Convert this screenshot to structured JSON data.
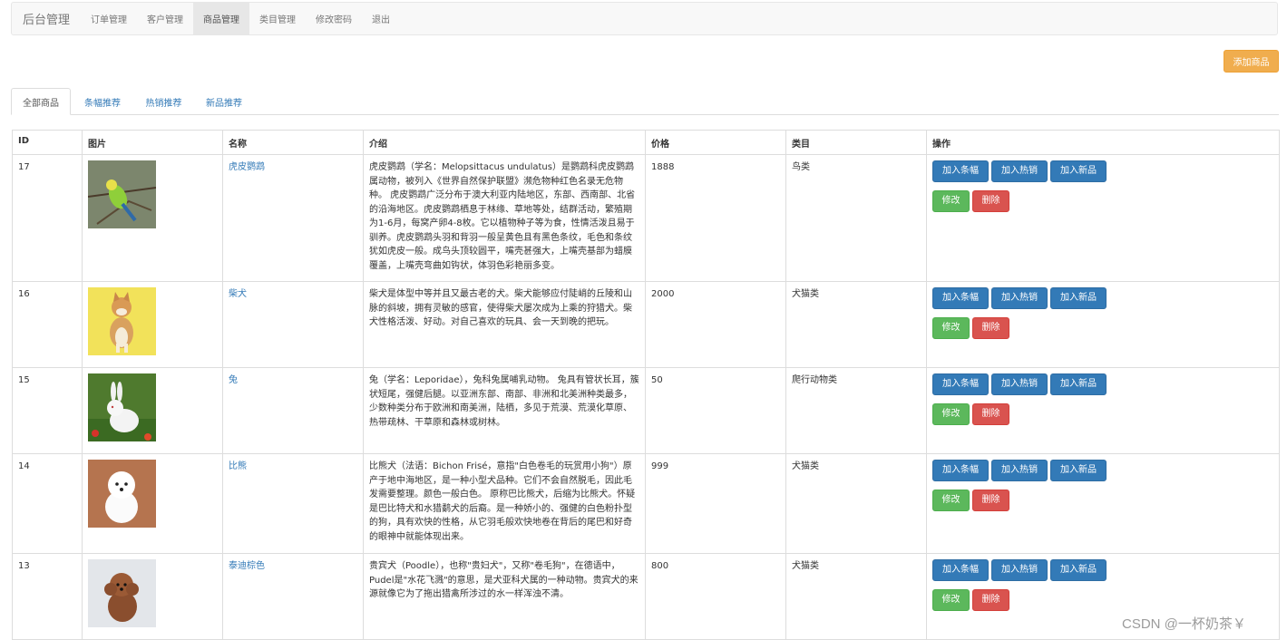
{
  "navbar": {
    "brand": "后台管理",
    "items": [
      {
        "label": "订单管理"
      },
      {
        "label": "客户管理"
      },
      {
        "label": "商品管理"
      },
      {
        "label": "类目管理"
      },
      {
        "label": "修改密码"
      },
      {
        "label": "退出"
      }
    ]
  },
  "add_button": "添加商品",
  "tabs": [
    {
      "label": "全部商品"
    },
    {
      "label": "条幅推荐"
    },
    {
      "label": "热销推荐"
    },
    {
      "label": "新品推荐"
    }
  ],
  "table": {
    "headers": [
      "ID",
      "图片",
      "名称",
      "介绍",
      "价格",
      "类目",
      "操作"
    ],
    "actions": {
      "banner": "加入条幅",
      "hot": "加入热销",
      "new": "加入新品",
      "edit": "修改",
      "delete": "删除"
    },
    "rows": [
      {
        "id": "17",
        "name": "虎皮鹦鹉",
        "description": "虎皮鹦鹉（学名：Melopsittacus undulatus）是鹦鹉科虎皮鹦鹉属动物，被列入《世界自然保护联盟》濒危物种红色名录无危物种。 虎皮鹦鹉广泛分布于澳大利亚内陆地区，东部、西南部、北省的沿海地区。虎皮鹦鹉栖息于林缘、草地等处，结群活动，繁殖期为1-6月，每窝产卵4-8枚。它以植物种子等为食，性情活泼且易于驯养。虎皮鹦鹉头羽和背羽一般呈黄色且有黑色条纹，毛色和条纹犹如虎皮一般。成鸟头顶较圆平，嘴壳甚强大，上嘴壳基部为蜡膜覆盖，上嘴壳弯曲如钩状，体羽色彩艳丽多变。",
        "price": "1888",
        "category": "鸟类",
        "image": "parakeet"
      },
      {
        "id": "16",
        "name": "柴犬",
        "description": "柴犬是体型中等并且又最古老的犬。柴犬能够应付陡峭的丘陵和山脉的斜坡，拥有灵敏的感官，使得柴犬屡次成为上乘的狩猎犬。柴犬性格活泼、好动。对自己喜欢的玩具、会一天到晚的把玩。",
        "price": "2000",
        "category": "犬猫类",
        "image": "shiba"
      },
      {
        "id": "15",
        "name": "兔",
        "description": "兔（学名：Leporidae），兔科兔属哺乳动物。 兔具有管状长耳，簇状短尾，强健后腿。以亚洲东部、南部、非洲和北美洲种类最多，少数种类分布于欧洲和南美洲，陆栖，多见于荒漠、荒漠化草原、热带疏林、干草原和森林或树林。",
        "price": "50",
        "category": "爬行动物类",
        "image": "rabbit"
      },
      {
        "id": "14",
        "name": "比熊",
        "description": "比熊犬（法语：Bichon Frisé，意指\"白色卷毛的玩赏用小狗\"）原产于地中海地区，是一种小型犬品种。它们不会自然脱毛，因此毛发需要整理。颜色一般白色。 原称巴比熊犬，后缩为比熊犬。怀疑是巴比特犬和水猎鹬犬的后裔。是一种娇小的、强健的白色粉扑型的狗，具有欢快的性格，从它羽毛般欢快地卷在背后的尾巴和好奇的眼神中就能体现出来。",
        "price": "999",
        "category": "犬猫类",
        "image": "bichon"
      },
      {
        "id": "13",
        "name": "泰迪棕色",
        "description": "贵宾犬（Poodle），也称\"贵妇犬\"，又称\"卷毛狗\"，在德语中，Pudel是\"水花飞溅\"的意思，是犬亚科犬属的一种动物。贵宾犬的来源就像它为了拖出猎禽所涉过的水一样浑浊不清。",
        "price": "800",
        "category": "犬猫类",
        "image": "poodle"
      }
    ]
  },
  "watermark": "CSDN @一杯奶茶￥"
}
